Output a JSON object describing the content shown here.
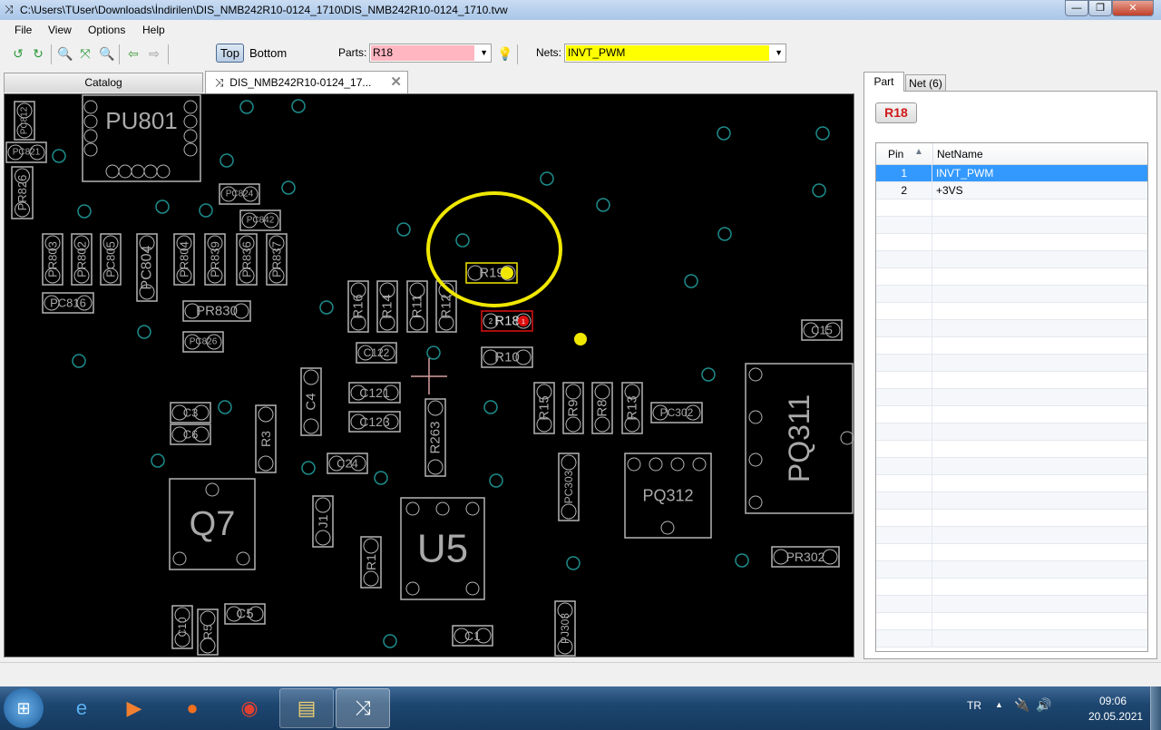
{
  "window": {
    "title": "C:\\Users\\TUser\\Downloads\\İndirilen\\DIS_NMB242R10-0124_1710\\DIS_NMB242R10-0124_1710.tvw"
  },
  "menu": [
    "File",
    "View",
    "Options",
    "Help"
  ],
  "toolbar": {
    "top_label": "Top",
    "bottom_label": "Bottom",
    "parts_label": "Parts:",
    "parts_value": "R18",
    "nets_label": "Nets:",
    "nets_value": "INVT_PWM"
  },
  "tabs": {
    "catalog": "Catalog",
    "document": "DIS_NMB242R10-0124_17..."
  },
  "board": {
    "components": [
      "PU801",
      "PC812",
      "PC821",
      "PR826",
      "PC824",
      "PC842",
      "PR803",
      "PR802",
      "PC805",
      "PC804",
      "PR804",
      "PR839",
      "PR836",
      "PR837",
      "PC816",
      "PR830",
      "PC826",
      "R16",
      "R14",
      "R11",
      "R12",
      "R19",
      "R18",
      "R10",
      "C122",
      "C4",
      "C121",
      "C123",
      "R263",
      "C24",
      "C3",
      "C6",
      "R3",
      "Q7",
      "J1",
      "U5",
      "R1",
      "R15",
      "R9",
      "R8",
      "R13",
      "PC302",
      "PC303",
      "PQ312",
      "PQ311",
      "C15",
      "PR302",
      "C5",
      "C10",
      "R5",
      "C1",
      "PJ303"
    ],
    "selected_part": "R18",
    "highlighted_part": "R19",
    "selected_pin_labels": [
      "2",
      "1"
    ],
    "colors": {
      "outline": "#b4b4b4",
      "via": "#1e8c8c",
      "selected": "#e01010",
      "highlight": "#f0e800"
    }
  },
  "panel": {
    "tabs": [
      "Part",
      "Net (6)"
    ],
    "part_button": "R18",
    "columns": [
      "Pin",
      "NetName"
    ],
    "rows": [
      {
        "pin": "1",
        "net": "INVT_PWM"
      },
      {
        "pin": "2",
        "net": "+3VS"
      }
    ]
  },
  "taskbar": {
    "lang": "TR",
    "time": "09:06",
    "date": "20.05.2021"
  }
}
